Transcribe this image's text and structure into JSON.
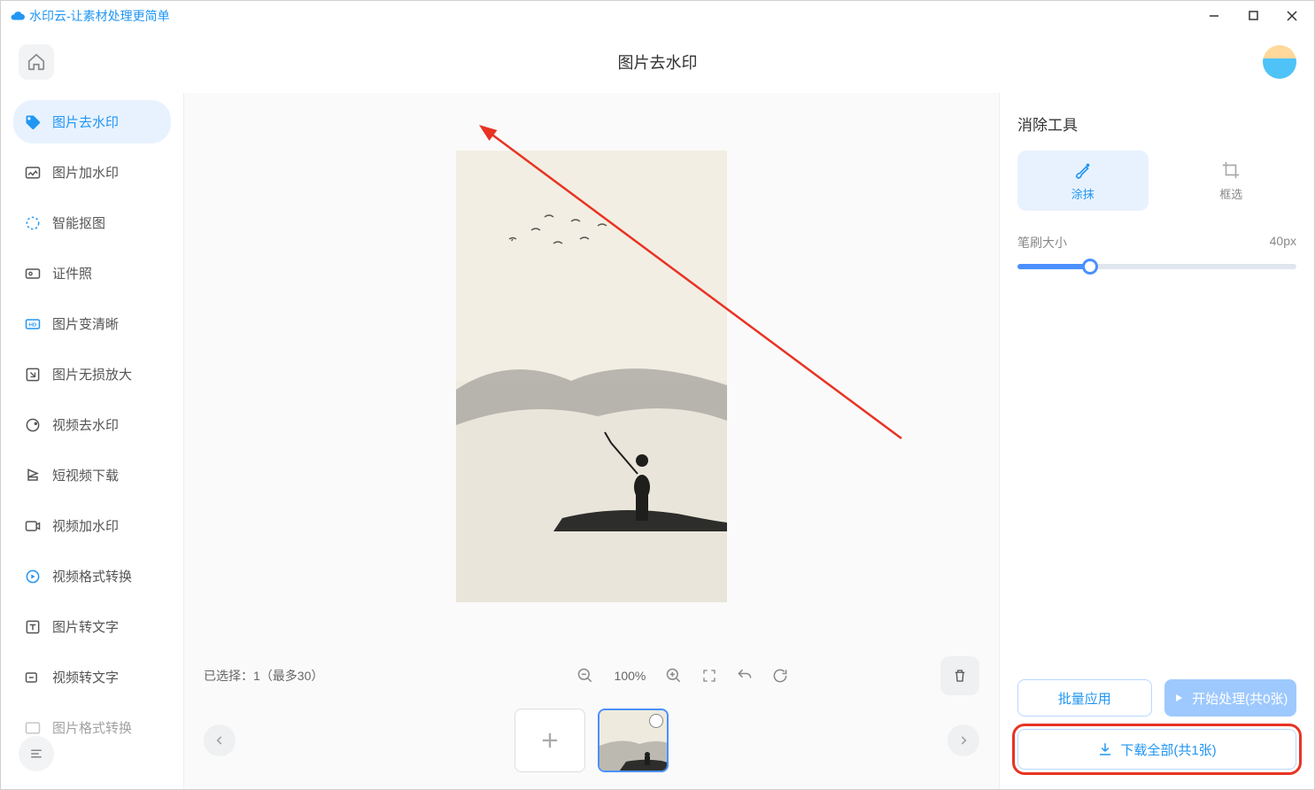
{
  "app": {
    "title": "水印云-让素材处理更简单"
  },
  "header": {
    "page_title": "图片去水印"
  },
  "sidebar": {
    "items": [
      {
        "label": "图片去水印"
      },
      {
        "label": "图片加水印"
      },
      {
        "label": "智能抠图"
      },
      {
        "label": "证件照"
      },
      {
        "label": "图片变清晰"
      },
      {
        "label": "图片无损放大"
      },
      {
        "label": "视频去水印"
      },
      {
        "label": "短视频下载"
      },
      {
        "label": "视频加水印"
      },
      {
        "label": "视频格式转换"
      },
      {
        "label": "图片转文字"
      },
      {
        "label": "视频转文字"
      },
      {
        "label": "图片格式转换"
      }
    ]
  },
  "toolbar": {
    "status": "已选择：1（最多30）",
    "zoom": "100%"
  },
  "panel": {
    "title": "消除工具",
    "tab_brush": "涂抹",
    "tab_rect": "框选",
    "brush_label": "笔刷大小",
    "brush_value": "40px"
  },
  "actions": {
    "batch": "批量应用",
    "start": "开始处理(共0张)",
    "download": "下载全部(共1张)"
  },
  "accent": "#2196f3"
}
